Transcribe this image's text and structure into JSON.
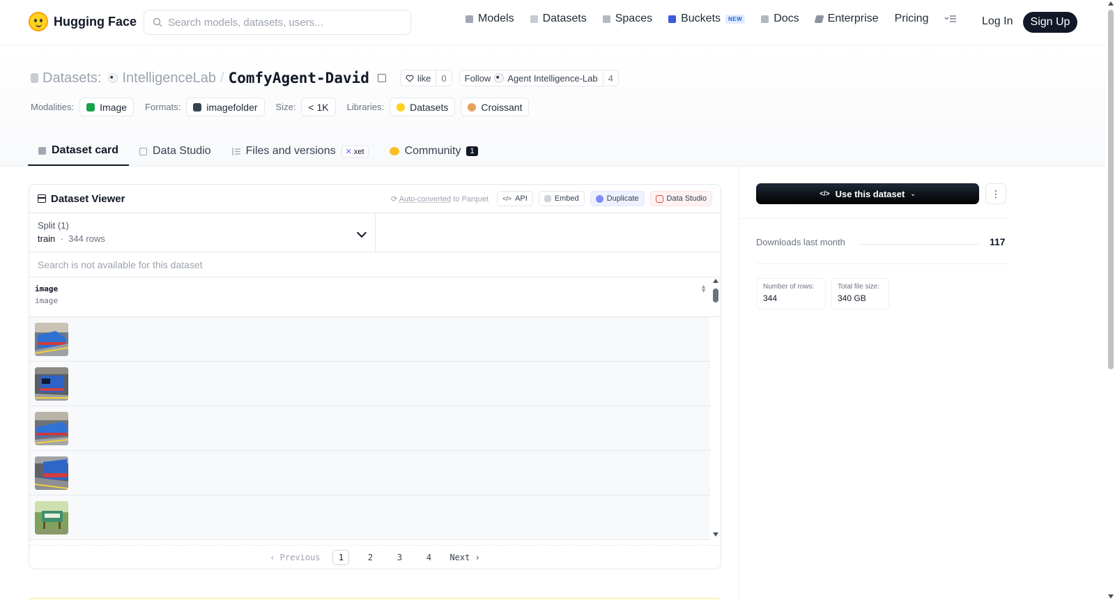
{
  "nav": {
    "brand": "Hugging Face",
    "search_placeholder": "Search models, datasets, users...",
    "links": [
      {
        "label": "Models",
        "icon": "cube-icon",
        "color": "#a3a8b4"
      },
      {
        "label": "Datasets",
        "icon": "database-icon",
        "color": "#c7cbd3"
      },
      {
        "label": "Spaces",
        "icon": "grid-icon",
        "color": "#b3b8c2"
      },
      {
        "label": "Buckets",
        "icon": "bucket-icon",
        "color": "#3b5bdb",
        "badge": "NEW"
      },
      {
        "label": "Docs",
        "icon": "book-icon",
        "color": "#b3b8c2"
      },
      {
        "label": "Enterprise",
        "icon": "enterprise-icon",
        "color": "#8b93a1"
      },
      {
        "label": "Pricing"
      }
    ],
    "login": "Log In",
    "signup": "Sign Up"
  },
  "header": {
    "prefix": "Datasets:",
    "org": "IntelligenceLab",
    "sep": "/",
    "name": "ComfyAgent-David",
    "like_label": "like",
    "like_count": "0",
    "follow_label": "Follow",
    "follow_org": "Agent Intelligence-Lab",
    "follow_count": "4",
    "meta": {
      "modalities_label": "Modalities:",
      "modality": "Image",
      "formats_label": "Formats:",
      "format": "imagefolder",
      "size_label": "Size:",
      "size": "< 1K",
      "libraries_label": "Libraries:",
      "lib1": "Datasets",
      "lib2": "Croissant"
    }
  },
  "tabs": [
    {
      "label": "Dataset card",
      "active": true
    },
    {
      "label": "Data Studio"
    },
    {
      "label": "Files and versions",
      "badge": "xet"
    },
    {
      "label": "Community",
      "count": "1"
    }
  ],
  "viewer": {
    "title": "Dataset Viewer",
    "auto_converted": "Auto-converted",
    "to_parquet": "to Parquet",
    "api": "API",
    "embed": "Embed",
    "duplicate": "Duplicate",
    "data_studio": "Data Studio",
    "split_label": "Split (1)",
    "split_name": "train",
    "split_rows": "344 rows",
    "search_na": "Search is not available for this dataset",
    "column_name": "image",
    "column_type": "image",
    "pager": {
      "prev": "Previous",
      "pages": [
        "1",
        "2",
        "3",
        "4"
      ],
      "next": "Next",
      "current": "1"
    }
  },
  "sidebar": {
    "use_button": "Use this dataset",
    "downloads_label": "Downloads last month",
    "downloads_value": "117",
    "rows_label": "Number of rows:",
    "rows_value": "344",
    "size_label": "Total file size:",
    "size_value": "340 GB"
  }
}
